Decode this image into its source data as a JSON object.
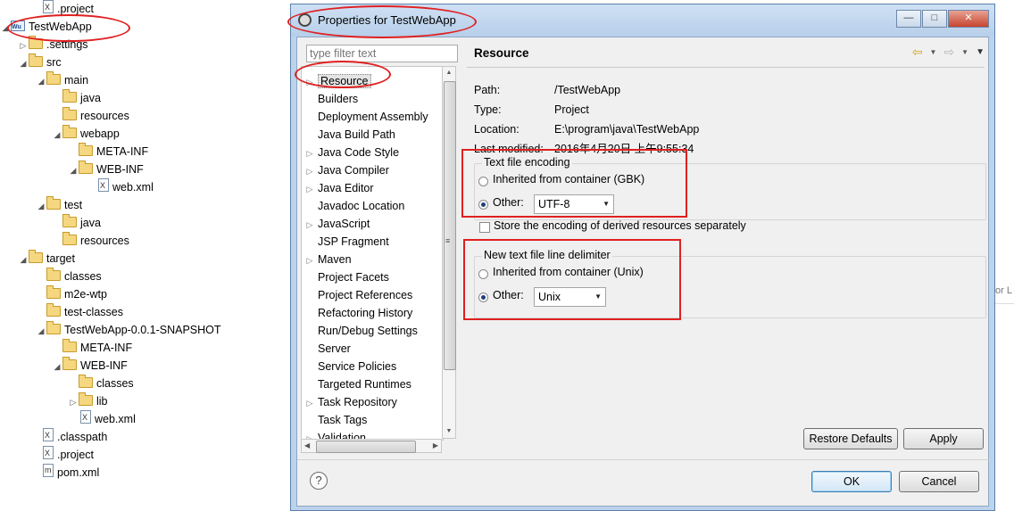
{
  "tree": [
    {
      "label": ".project",
      "level": 2,
      "icon": "xml-file-icon",
      "arrow": ""
    },
    {
      "label": "TestWebApp",
      "level": 0,
      "icon": "project-icon",
      "arrow": "◢"
    },
    {
      "label": ".settings",
      "level": 1,
      "icon": "folder-icon",
      "arrow": "▷"
    },
    {
      "label": "src",
      "level": 1,
      "icon": "folder-icon",
      "arrow": "◢"
    },
    {
      "label": "main",
      "level": 2,
      "icon": "folder-icon",
      "arrow": "◢"
    },
    {
      "label": "java",
      "level": 3,
      "icon": "folder-icon",
      "arrow": ""
    },
    {
      "label": "resources",
      "level": 3,
      "icon": "folder-icon",
      "arrow": ""
    },
    {
      "label": "webapp",
      "level": 3,
      "icon": "folder-icon",
      "arrow": "◢"
    },
    {
      "label": "META-INF",
      "level": 4,
      "icon": "folder-icon",
      "arrow": ""
    },
    {
      "label": "WEB-INF",
      "level": 4,
      "icon": "folder-icon",
      "arrow": "◢"
    },
    {
      "label": "web.xml",
      "level": 5,
      "icon": "xml-file-icon",
      "arrow": ""
    },
    {
      "label": "test",
      "level": 2,
      "icon": "folder-icon",
      "arrow": "◢"
    },
    {
      "label": "java",
      "level": 3,
      "icon": "folder-icon",
      "arrow": ""
    },
    {
      "label": "resources",
      "level": 3,
      "icon": "folder-icon",
      "arrow": ""
    },
    {
      "label": "target",
      "level": 1,
      "icon": "folder-icon",
      "arrow": "◢"
    },
    {
      "label": "classes",
      "level": 2,
      "icon": "folder-icon",
      "arrow": ""
    },
    {
      "label": "m2e-wtp",
      "level": 2,
      "icon": "folder-icon",
      "arrow": ""
    },
    {
      "label": "test-classes",
      "level": 2,
      "icon": "folder-icon",
      "arrow": ""
    },
    {
      "label": "TestWebApp-0.0.1-SNAPSHOT",
      "level": 2,
      "icon": "folder-icon",
      "arrow": "◢"
    },
    {
      "label": "META-INF",
      "level": 3,
      "icon": "folder-icon",
      "arrow": ""
    },
    {
      "label": "WEB-INF",
      "level": 3,
      "icon": "folder-icon",
      "arrow": "◢"
    },
    {
      "label": "classes",
      "level": 4,
      "icon": "folder-icon",
      "arrow": ""
    },
    {
      "label": "lib",
      "level": 4,
      "icon": "folder-icon",
      "arrow": "▷"
    },
    {
      "label": "web.xml",
      "level": 4,
      "icon": "xml-file-icon",
      "arrow": ""
    },
    {
      "label": ".classpath",
      "level": 1,
      "icon": "xml-file-icon",
      "arrow": ""
    },
    {
      "label": ".project",
      "level": 1,
      "icon": "xml-file-icon",
      "arrow": ""
    },
    {
      "label": "pom.xml",
      "level": 1,
      "icon": "pom-file-icon",
      "arrow": ""
    }
  ],
  "dialog": {
    "title": "Properties for TestWebApp",
    "filter_placeholder": "type filter text",
    "nav_items": [
      {
        "label": "Resource",
        "arrow": "▷",
        "selected": true
      },
      {
        "label": "Builders",
        "arrow": ""
      },
      {
        "label": "Deployment Assembly",
        "arrow": ""
      },
      {
        "label": "Java Build Path",
        "arrow": ""
      },
      {
        "label": "Java Code Style",
        "arrow": "▷"
      },
      {
        "label": "Java Compiler",
        "arrow": "▷"
      },
      {
        "label": "Java Editor",
        "arrow": "▷"
      },
      {
        "label": "Javadoc Location",
        "arrow": ""
      },
      {
        "label": "JavaScript",
        "arrow": "▷"
      },
      {
        "label": "JSP Fragment",
        "arrow": ""
      },
      {
        "label": "Maven",
        "arrow": "▷"
      },
      {
        "label": "Project Facets",
        "arrow": ""
      },
      {
        "label": "Project References",
        "arrow": ""
      },
      {
        "label": "Refactoring History",
        "arrow": ""
      },
      {
        "label": "Run/Debug Settings",
        "arrow": ""
      },
      {
        "label": "Server",
        "arrow": ""
      },
      {
        "label": "Service Policies",
        "arrow": ""
      },
      {
        "label": "Targeted Runtimes",
        "arrow": ""
      },
      {
        "label": "Task Repository",
        "arrow": "▷"
      },
      {
        "label": "Task Tags",
        "arrow": ""
      },
      {
        "label": "Validation",
        "arrow": "▷"
      }
    ],
    "page_title": "Resource",
    "props": {
      "path_label": "Path:",
      "path_value": "/TestWebApp",
      "type_label": "Type:",
      "type_value": "Project",
      "location_label": "Location:",
      "location_value": "E:\\program\\java\\TestWebApp",
      "modified_label": "Last modified:",
      "modified_value": "2016年4月20日 上午9:55:34"
    },
    "encoding": {
      "group_title": "Text file encoding",
      "inherited_label": "Inherited from container (GBK)",
      "other_label": "Other:",
      "other_value": "UTF-8",
      "store_label": "Store the encoding of derived resources separately"
    },
    "delimiter": {
      "group_title": "New text file line delimiter",
      "inherited_label": "Inherited from container (Unix)",
      "other_label": "Other:",
      "other_value": "Unix"
    },
    "restore_label": "Restore Defaults",
    "apply_label": "Apply",
    "ok_label": "OK",
    "cancel_label": "Cancel",
    "help_glyph": "?"
  },
  "right_fragment": "or L"
}
